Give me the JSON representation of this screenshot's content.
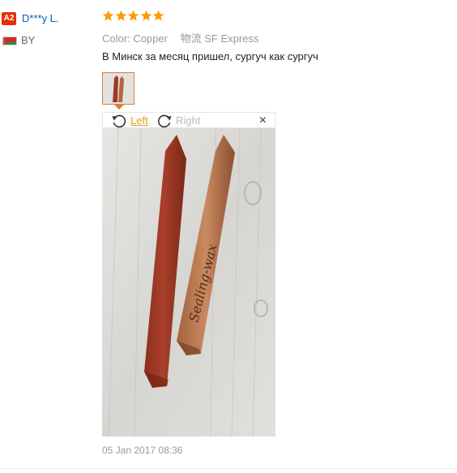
{
  "user": {
    "level_badge": "A2",
    "name": "D***y L.",
    "country": "BY"
  },
  "review": {
    "rating": 5,
    "sku": {
      "color_label": "Color:",
      "color_value": "Copper",
      "shipping_label": "物流",
      "shipping_value": "SF Express"
    },
    "text": "В Минск за месяц пришел, сургуч как сургуч",
    "viewer": {
      "rotate_left_label": "Left",
      "rotate_right_label": "Right",
      "close_symbol": "×"
    },
    "photo": {
      "engraving_text": "Sealing-wax"
    },
    "date": "05 Jan 2017 08:36"
  },
  "colors": {
    "star": "#ff9a00",
    "accent_orange": "#e27a3a",
    "link_blue": "#0b5bb5",
    "badge_red": "#e62e04"
  }
}
